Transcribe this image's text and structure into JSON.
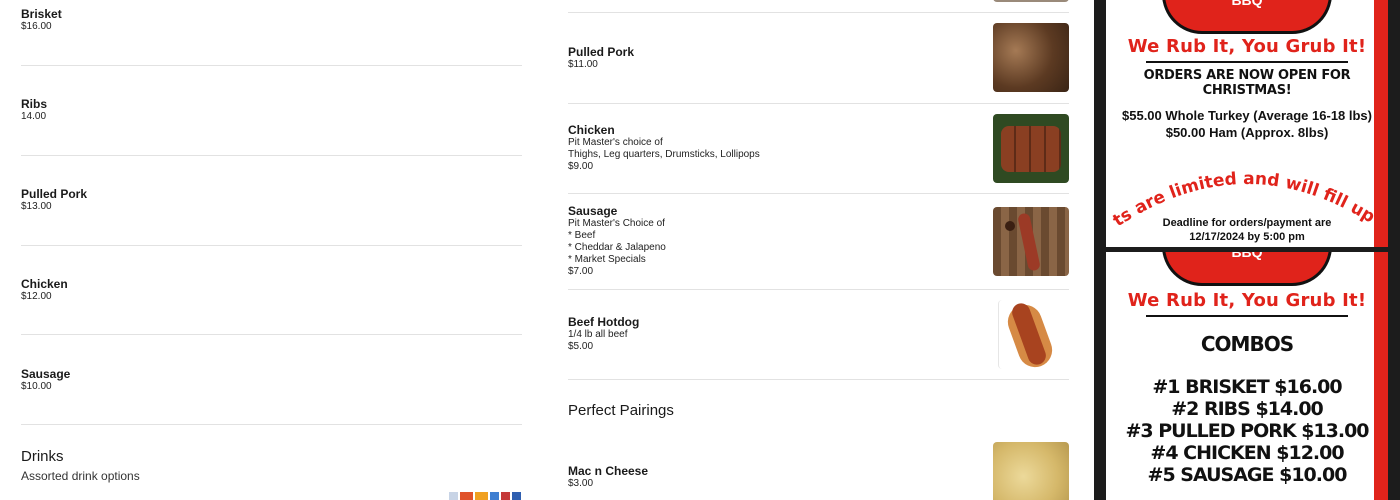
{
  "combo_menu": {
    "items": [
      {
        "name": "Brisket",
        "price": "$16.00"
      },
      {
        "name": "Ribs",
        "price": "14.00"
      },
      {
        "name": "Pulled Pork",
        "price": "$13.00"
      },
      {
        "name": "Chicken",
        "price": "$12.00"
      },
      {
        "name": "Sausage",
        "price": "$10.00"
      }
    ]
  },
  "drinks": {
    "title": "Drinks",
    "subtitle": "Assorted drink options"
  },
  "meats": {
    "items": [
      {
        "name": "Pulled Pork",
        "description": "",
        "price": "$11.00",
        "thumb_color": "#6b4a33",
        "thumb_icon": "pulled-pork-photo"
      },
      {
        "name": "Chicken",
        "description": "Pit Master's choice of\nThighs, Leg quarters, Drumsticks, Lollipops",
        "price": "$9.00",
        "thumb_color": "#7a3b22",
        "thumb_icon": "chicken-photo"
      },
      {
        "name": "Sausage",
        "description": "Pit Master's Choice of\n* Beef\n* Cheddar & Jalapeno\n* Market Specials",
        "price": "$7.00",
        "thumb_color": "#8a5a3a",
        "thumb_icon": "sausage-photo"
      },
      {
        "name": "Beef Hotdog",
        "description": "1/4 lb all beef",
        "price": "$5.00",
        "thumb_color": "#c27a3c",
        "thumb_icon": "hotdog-photo"
      }
    ]
  },
  "pairings": {
    "title": "Perfect Pairings",
    "items": [
      {
        "name": "Mac n Cheese",
        "price": "$3.00",
        "thumb_color": "#d9c27a",
        "thumb_icon": "mac-n-cheese-photo"
      }
    ]
  },
  "flyer_christmas": {
    "logo": "BBQ",
    "slogan": "We Rub It, You Grub It!",
    "headline": "ORDERS ARE NOW OPEN FOR CHRISTMAS!",
    "turkey": "$55.00 Whole Turkey (Average 16-18 lbs)",
    "ham": "$50.00 Ham (Approx. 8lbs)",
    "arc_text": "Spots are limited and will fill up fast",
    "deadline_1": "Deadline for orders/payment are",
    "deadline_2": "12/17/2024 by 5:00 pm"
  },
  "flyer_combos": {
    "logo": "BBQ",
    "slogan": "We Rub It, You Grub It!",
    "headline": "COMBOS",
    "lines": [
      "#1 BRISKET  $16.00",
      "#2 RIBS $14.00",
      "#3 PULLED PORK $13.00",
      "#4 CHICKEN $12.00",
      "#5 SAUSAGE $10.00"
    ]
  },
  "colors": {
    "brand_red": "#e0231b",
    "divider": "#e2e2e2"
  }
}
